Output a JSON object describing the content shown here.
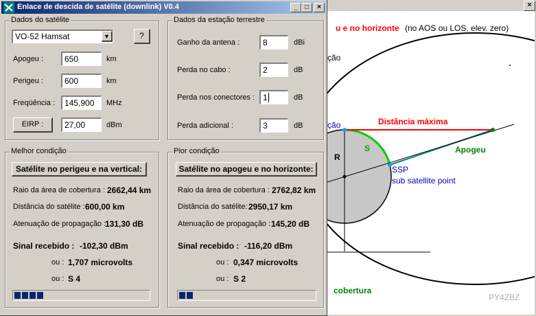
{
  "window_title": "Enlace de descida de satélite (downlink)  V0.4",
  "title_buttons": {
    "minimize": "_",
    "maximize": "□",
    "close": "×"
  },
  "satellite_group": {
    "title": "Dados do satélite",
    "satellite": "VO-52 Hamsat",
    "help_button": "?",
    "apogee_label": "Apogeu :",
    "apogee_value": "650",
    "apogee_unit": "km",
    "perigee_label": "Perigeu :",
    "perigee_value": "600",
    "perigee_unit": "km",
    "freq_label": "Freqüência :",
    "freq_value": "145,900",
    "freq_unit": "MHz",
    "eirp_button": "EIRP :",
    "eirp_value": "27,00",
    "eirp_unit": "dBm"
  },
  "station_group": {
    "title": "Dados da estação terrestre",
    "gain_label": "Ganho da antena :",
    "gain_value": "8",
    "gain_unit": "dBi",
    "cable_label": "Perda no cabo :",
    "cable_value": "2",
    "cable_unit": "dB",
    "conn_label": "Perda nos conectores :",
    "conn_value": "1",
    "conn_unit": "dB",
    "extra_label": "Perda adicional :",
    "extra_value": "3",
    "extra_unit": "dB"
  },
  "best": {
    "title": "Melhor condição",
    "button": "Satélite no perigeu e na vertical:",
    "radius_label": "Raio da área de cobertura :",
    "radius_value": "2662,44 km",
    "dist_label": "Distância do satélite :",
    "dist_value": "600,00 km",
    "att_label": "Atenuação de propagação :",
    "att_value": "131,30 dB",
    "signal_label": "Sinal recebido :",
    "signal_value": "-102,30 dBm",
    "or1_label": "ou :",
    "or1_value": "1,707 microvolts",
    "or2_label": "ou :",
    "or2_value": "S 4",
    "s_level": 4
  },
  "worst": {
    "title": "Pior condição",
    "button": "Satélite no apogeu e no horizonte:",
    "radius_label": "Raio da área de cobertura :",
    "radius_value": "2762,82 km",
    "dist_label": "Distância do satélite:",
    "dist_value": "2950,17 km",
    "att_label": "Atenuação de propagação :",
    "att_value": "145,20 dB",
    "signal_label": "Sinal recebido :",
    "signal_value": "-116,20 dBm",
    "or1_label": "ou :",
    "or1_value": "0,347 microvolts",
    "or2_label": "ou :",
    "or2_value": "S 2",
    "s_level": 2
  },
  "diagram": {
    "heading_red": "u e no horizonte",
    "heading_black": "(no AOS ou LOS, elev. zero)",
    "partial_left_1": "ção",
    "partial_left_2": "ção",
    "max_distance": "Distância máxima",
    "apogee": "Apogeu",
    "s_label": "S",
    "r_label": "R",
    "ssp": "SSP",
    "ssp_desc": "sub satellite point",
    "coverage": "cobertura",
    "credit": "PY4ZBZ",
    "colors": {
      "red": "#ff0000",
      "green": "#008000",
      "blue": "#0000c0",
      "teal": "#008080"
    }
  }
}
